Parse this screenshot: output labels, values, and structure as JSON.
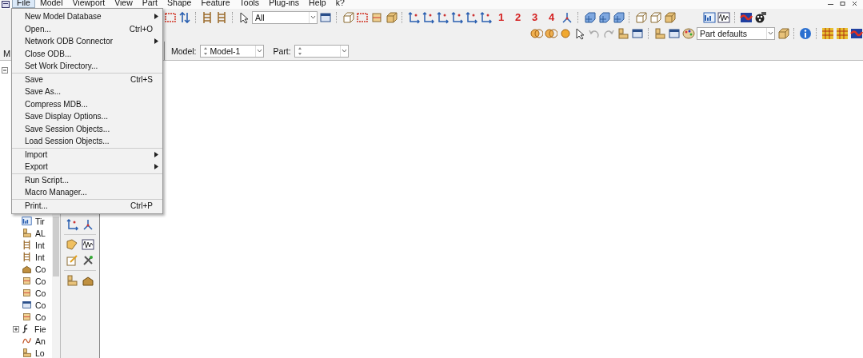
{
  "menubar": [
    {
      "label": "File",
      "selected": true
    },
    {
      "label": "Model",
      "selected": false
    },
    {
      "label": "Viewport",
      "selected": false
    },
    {
      "label": "View",
      "selected": false
    },
    {
      "label": "Part",
      "selected": false
    },
    {
      "label": "Shape",
      "selected": false
    },
    {
      "label": "Feature",
      "selected": false
    },
    {
      "label": "Tools",
      "selected": false
    },
    {
      "label": "Plug-ins",
      "selected": false
    },
    {
      "label": "Help",
      "selected": false
    },
    {
      "label": "k?",
      "selected": false
    }
  ],
  "file_menu": [
    {
      "kind": "item",
      "label": "New Model Database",
      "submenu": true
    },
    {
      "kind": "item",
      "label": "Open...",
      "shortcut": "Ctrl+O",
      "submenu": false
    },
    {
      "kind": "item",
      "label": "Network ODB Connector",
      "submenu": true
    },
    {
      "kind": "item",
      "label": "Close ODB...",
      "submenu": false
    },
    {
      "kind": "item",
      "label": "Set Work Directory...",
      "submenu": false
    },
    {
      "kind": "separator"
    },
    {
      "kind": "item",
      "label": "Save",
      "shortcut": "Ctrl+S",
      "submenu": false
    },
    {
      "kind": "item",
      "label": "Save As...",
      "submenu": false
    },
    {
      "kind": "item",
      "label": "Compress MDB...",
      "submenu": false
    },
    {
      "kind": "item",
      "label": "Save Display Options...",
      "submenu": false
    },
    {
      "kind": "item",
      "label": "Save Session Objects...",
      "submenu": false
    },
    {
      "kind": "item",
      "label": "Load Session Objects...",
      "submenu": false
    },
    {
      "kind": "separator"
    },
    {
      "kind": "item",
      "label": "Import",
      "submenu": true
    },
    {
      "kind": "item",
      "label": "Export",
      "submenu": true
    },
    {
      "kind": "separator"
    },
    {
      "kind": "item",
      "label": "Run Script...",
      "submenu": false
    },
    {
      "kind": "item",
      "label": "Macro Manager...",
      "submenu": false
    },
    {
      "kind": "separator"
    },
    {
      "kind": "item",
      "label": "Print...",
      "shortcut": "Ctrl+P",
      "submenu": false
    }
  ],
  "toolbar": {
    "selection_filter": "All",
    "view_numbers": [
      "1",
      "2",
      "3",
      "4"
    ],
    "render_style": "Part defaults"
  },
  "context_bar": {
    "model_label": "Model:",
    "model_value": "Model-1",
    "part_label": "Part:"
  },
  "module_tab": "M",
  "tree": [
    {
      "label": "Tir",
      "kind": "leaf"
    },
    {
      "label": "AL",
      "kind": "leaf"
    },
    {
      "label": "Int",
      "kind": "leaf"
    },
    {
      "label": "Int",
      "kind": "leaf"
    },
    {
      "label": "Co",
      "kind": "leaf"
    },
    {
      "label": "Co",
      "kind": "leaf"
    },
    {
      "label": "Co",
      "kind": "leaf"
    },
    {
      "label": "Co",
      "kind": "leaf"
    },
    {
      "label": "Co",
      "kind": "leaf"
    },
    {
      "label": "Fie",
      "kind": "folder"
    },
    {
      "label": "An",
      "kind": "leaf"
    },
    {
      "label": "Lo",
      "kind": "leaf"
    }
  ]
}
